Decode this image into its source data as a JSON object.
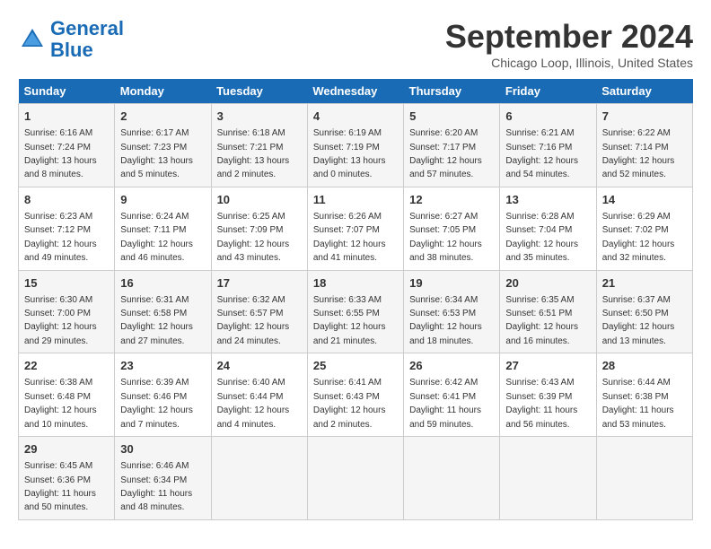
{
  "header": {
    "logo_line1": "General",
    "logo_line2": "Blue",
    "month": "September 2024",
    "location": "Chicago Loop, Illinois, United States"
  },
  "days_of_week": [
    "Sunday",
    "Monday",
    "Tuesday",
    "Wednesday",
    "Thursday",
    "Friday",
    "Saturday"
  ],
  "weeks": [
    [
      {
        "num": "1",
        "sunrise": "6:16 AM",
        "sunset": "7:24 PM",
        "daylight": "13 hours and 8 minutes."
      },
      {
        "num": "2",
        "sunrise": "6:17 AM",
        "sunset": "7:23 PM",
        "daylight": "13 hours and 5 minutes."
      },
      {
        "num": "3",
        "sunrise": "6:18 AM",
        "sunset": "7:21 PM",
        "daylight": "13 hours and 2 minutes."
      },
      {
        "num": "4",
        "sunrise": "6:19 AM",
        "sunset": "7:19 PM",
        "daylight": "13 hours and 0 minutes."
      },
      {
        "num": "5",
        "sunrise": "6:20 AM",
        "sunset": "7:17 PM",
        "daylight": "12 hours and 57 minutes."
      },
      {
        "num": "6",
        "sunrise": "6:21 AM",
        "sunset": "7:16 PM",
        "daylight": "12 hours and 54 minutes."
      },
      {
        "num": "7",
        "sunrise": "6:22 AM",
        "sunset": "7:14 PM",
        "daylight": "12 hours and 52 minutes."
      }
    ],
    [
      {
        "num": "8",
        "sunrise": "6:23 AM",
        "sunset": "7:12 PM",
        "daylight": "12 hours and 49 minutes."
      },
      {
        "num": "9",
        "sunrise": "6:24 AM",
        "sunset": "7:11 PM",
        "daylight": "12 hours and 46 minutes."
      },
      {
        "num": "10",
        "sunrise": "6:25 AM",
        "sunset": "7:09 PM",
        "daylight": "12 hours and 43 minutes."
      },
      {
        "num": "11",
        "sunrise": "6:26 AM",
        "sunset": "7:07 PM",
        "daylight": "12 hours and 41 minutes."
      },
      {
        "num": "12",
        "sunrise": "6:27 AM",
        "sunset": "7:05 PM",
        "daylight": "12 hours and 38 minutes."
      },
      {
        "num": "13",
        "sunrise": "6:28 AM",
        "sunset": "7:04 PM",
        "daylight": "12 hours and 35 minutes."
      },
      {
        "num": "14",
        "sunrise": "6:29 AM",
        "sunset": "7:02 PM",
        "daylight": "12 hours and 32 minutes."
      }
    ],
    [
      {
        "num": "15",
        "sunrise": "6:30 AM",
        "sunset": "7:00 PM",
        "daylight": "12 hours and 29 minutes."
      },
      {
        "num": "16",
        "sunrise": "6:31 AM",
        "sunset": "6:58 PM",
        "daylight": "12 hours and 27 minutes."
      },
      {
        "num": "17",
        "sunrise": "6:32 AM",
        "sunset": "6:57 PM",
        "daylight": "12 hours and 24 minutes."
      },
      {
        "num": "18",
        "sunrise": "6:33 AM",
        "sunset": "6:55 PM",
        "daylight": "12 hours and 21 minutes."
      },
      {
        "num": "19",
        "sunrise": "6:34 AM",
        "sunset": "6:53 PM",
        "daylight": "12 hours and 18 minutes."
      },
      {
        "num": "20",
        "sunrise": "6:35 AM",
        "sunset": "6:51 PM",
        "daylight": "12 hours and 16 minutes."
      },
      {
        "num": "21",
        "sunrise": "6:37 AM",
        "sunset": "6:50 PM",
        "daylight": "12 hours and 13 minutes."
      }
    ],
    [
      {
        "num": "22",
        "sunrise": "6:38 AM",
        "sunset": "6:48 PM",
        "daylight": "12 hours and 10 minutes."
      },
      {
        "num": "23",
        "sunrise": "6:39 AM",
        "sunset": "6:46 PM",
        "daylight": "12 hours and 7 minutes."
      },
      {
        "num": "24",
        "sunrise": "6:40 AM",
        "sunset": "6:44 PM",
        "daylight": "12 hours and 4 minutes."
      },
      {
        "num": "25",
        "sunrise": "6:41 AM",
        "sunset": "6:43 PM",
        "daylight": "12 hours and 2 minutes."
      },
      {
        "num": "26",
        "sunrise": "6:42 AM",
        "sunset": "6:41 PM",
        "daylight": "11 hours and 59 minutes."
      },
      {
        "num": "27",
        "sunrise": "6:43 AM",
        "sunset": "6:39 PM",
        "daylight": "11 hours and 56 minutes."
      },
      {
        "num": "28",
        "sunrise": "6:44 AM",
        "sunset": "6:38 PM",
        "daylight": "11 hours and 53 minutes."
      }
    ],
    [
      {
        "num": "29",
        "sunrise": "6:45 AM",
        "sunset": "6:36 PM",
        "daylight": "11 hours and 50 minutes."
      },
      {
        "num": "30",
        "sunrise": "6:46 AM",
        "sunset": "6:34 PM",
        "daylight": "11 hours and 48 minutes."
      },
      null,
      null,
      null,
      null,
      null
    ]
  ]
}
